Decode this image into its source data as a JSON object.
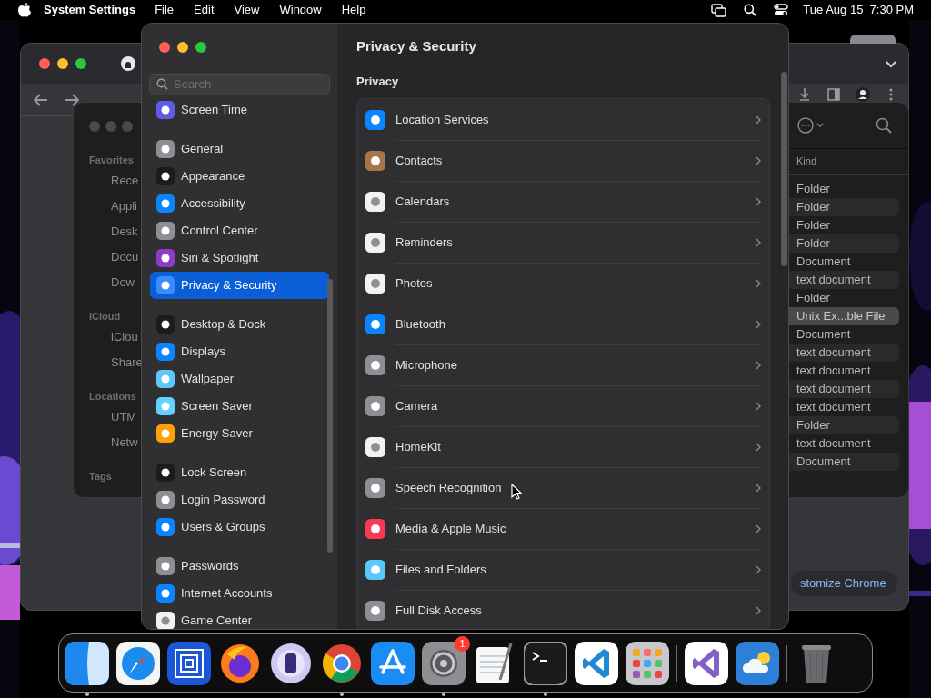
{
  "menu_bar": {
    "app": "System Settings",
    "menus": [
      "File",
      "Edit",
      "View",
      "Window",
      "Help"
    ],
    "clock": "Tue Aug 15  7:30 PM"
  },
  "browser_window": {
    "button": "stomize Chrome"
  },
  "finder_window": {
    "sidebar": [
      {
        "heading": "Favorites",
        "items": [
          "Rece",
          "Appli",
          "Desk",
          "Docu",
          "Dow"
        ]
      },
      {
        "heading": "iCloud",
        "items": [
          "iClou",
          "Share"
        ]
      },
      {
        "heading": "Locations",
        "items": [
          "UTM",
          "Netw"
        ]
      },
      {
        "heading": "Tags"
      }
    ],
    "column": "Kind",
    "rows": [
      {
        "text": "Folder",
        "selected": false
      },
      {
        "text": "Folder",
        "selected": false
      },
      {
        "text": "Folder",
        "selected": false
      },
      {
        "text": "Folder",
        "selected": false
      },
      {
        "text": "Document",
        "selected": false
      },
      {
        "text": "text document",
        "selected": false
      },
      {
        "text": "Folder",
        "selected": false
      },
      {
        "text": "Unix Ex...ble File",
        "selected": true
      },
      {
        "text": "Document",
        "selected": false
      },
      {
        "text": "text document",
        "selected": false
      },
      {
        "text": "text document",
        "selected": false
      },
      {
        "text": "text document",
        "selected": false
      },
      {
        "text": "text document",
        "selected": false
      },
      {
        "text": "Folder",
        "selected": false
      },
      {
        "text": "text document",
        "selected": false
      },
      {
        "text": "Document",
        "selected": false
      }
    ]
  },
  "settings_window": {
    "search": {
      "placeholder": "Search"
    },
    "sidebar": [
      {
        "items": [
          {
            "label": "Screen Time",
            "color": "#5e5ce6",
            "selected": false
          }
        ]
      },
      {
        "items": [
          {
            "label": "General",
            "color": "#8e8e93",
            "selected": false
          },
          {
            "label": "Appearance",
            "color": "#1c1c1e",
            "selected": false
          },
          {
            "label": "Accessibility",
            "color": "#0a84ff",
            "selected": false
          },
          {
            "label": "Control Center",
            "color": "#8e8e93",
            "selected": false
          },
          {
            "label": "Siri & Spotlight",
            "color": "#8e3cc8",
            "selected": false
          },
          {
            "label": "Privacy & Security",
            "color": "#3d8bff",
            "selected": true
          }
        ]
      },
      {
        "items": [
          {
            "label": "Desktop & Dock",
            "color": "#1c1c1e",
            "selected": false
          },
          {
            "label": "Displays",
            "color": "#0a84ff",
            "selected": false
          },
          {
            "label": "Wallpaper",
            "color": "#5ac8fa",
            "selected": false
          },
          {
            "label": "Screen Saver",
            "color": "#64d2ff",
            "selected": false
          },
          {
            "label": "Energy Saver",
            "color": "#ff9f0a",
            "selected": false
          }
        ]
      },
      {
        "items": [
          {
            "label": "Lock Screen",
            "color": "#1c1c1e",
            "selected": false
          },
          {
            "label": "Login Password",
            "color": "#8e8e93",
            "selected": false
          },
          {
            "label": "Users & Groups",
            "color": "#0a84ff",
            "selected": false
          }
        ]
      },
      {
        "items": [
          {
            "label": "Passwords",
            "color": "#8e8e93",
            "selected": false
          },
          {
            "label": "Internet Accounts",
            "color": "#0a84ff",
            "selected": false
          },
          {
            "label": "Game Center",
            "color": "#f2f2f2",
            "selected": false
          }
        ]
      }
    ],
    "title": "Privacy & Security",
    "section": "Privacy",
    "rows": [
      {
        "label": "Location Services",
        "color": "#0a84ff"
      },
      {
        "label": "Contacts",
        "color": "#a8754a"
      },
      {
        "label": "Calendars",
        "color": "#f2f2f2"
      },
      {
        "label": "Reminders",
        "color": "#f2f2f2"
      },
      {
        "label": "Photos",
        "color": "#f2f2f2"
      },
      {
        "label": "Bluetooth",
        "color": "#0a84ff"
      },
      {
        "label": "Microphone",
        "color": "#8e8e93"
      },
      {
        "label": "Camera",
        "color": "#8e8e93"
      },
      {
        "label": "HomeKit",
        "color": "#f2f2f2"
      },
      {
        "label": "Speech Recognition",
        "color": "#8e8e93"
      },
      {
        "label": "Media & Apple Music",
        "color": "#fa3a55"
      },
      {
        "label": "Files and Folders",
        "color": "#5ac8fa"
      },
      {
        "label": "Full Disk Access",
        "color": "#8e8e93"
      }
    ]
  },
  "dock": {
    "sections": [
      {
        "items": [
          {
            "running": true
          },
          {
            "running": false
          },
          {
            "running": false
          },
          {
            "running": false
          },
          {
            "running": false
          },
          {
            "running": true
          },
          {
            "running": false
          },
          {
            "running": true,
            "badge": "1"
          },
          {
            "running": false
          },
          {
            "running": true
          },
          {
            "running": false
          },
          {
            "running": false
          }
        ]
      },
      {
        "items": [
          {
            "running": false
          },
          {
            "running": false
          }
        ]
      },
      {
        "items": [
          {
            "running": false
          }
        ]
      }
    ]
  }
}
